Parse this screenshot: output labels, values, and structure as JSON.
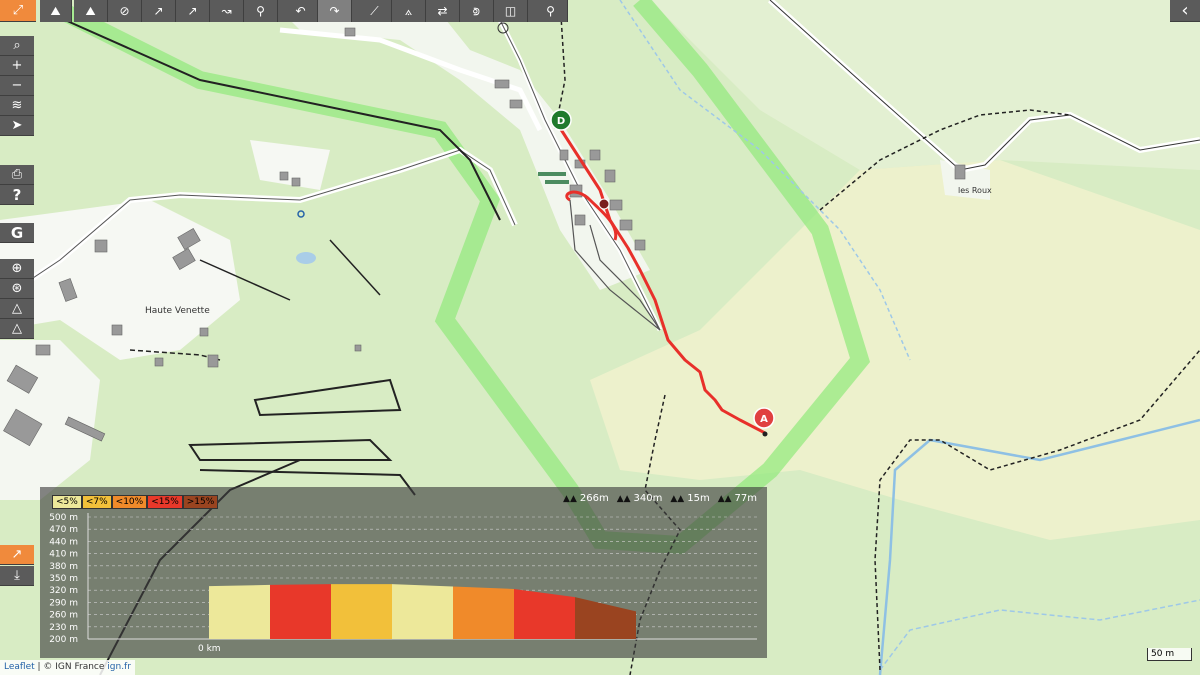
{
  "map": {
    "labels": [
      {
        "key": "haute_venette",
        "text": "Haute Venette"
      },
      {
        "key": "les_roux",
        "text": "les Roux"
      },
      {
        "key": "marker_start",
        "text": "D"
      },
      {
        "key": "marker_end",
        "text": "A"
      }
    ],
    "colors": {
      "track": "#e8302a",
      "forest": "#c9e4ad",
      "meadow": "#eef2cc",
      "park_border": "#8fe87a",
      "water": "#9ec8e8"
    }
  },
  "toolbar": {
    "items": [
      {
        "name": "hiker-icon",
        "glyph": "⛰"
      },
      {
        "name": "hide-route-icon",
        "glyph": "⊘"
      },
      {
        "name": "line-mode-icon",
        "glyph": "↗"
      },
      {
        "name": "line-mode-2-icon",
        "glyph": "↗"
      },
      {
        "name": "route-mode-icon",
        "glyph": "↝"
      },
      {
        "name": "bike-icon",
        "glyph": "⚲"
      },
      {
        "name": "undo-icon",
        "glyph": "↶"
      },
      {
        "name": "redo-icon",
        "glyph": "↷"
      },
      {
        "name": "route-edit-icon",
        "glyph": "⟋"
      },
      {
        "name": "route-split-icon",
        "glyph": "⟑"
      },
      {
        "name": "reverse-icon",
        "glyph": "⇄"
      },
      {
        "name": "ruler-icon",
        "glyph": "⟄"
      },
      {
        "name": "layers-select-icon",
        "glyph": "◫"
      },
      {
        "name": "pin-icon",
        "glyph": "⚲"
      }
    ]
  },
  "controls": {
    "expand_glyph": "⤢",
    "search_glyph": "⌕",
    "zoom_in": "+",
    "zoom_out": "−",
    "layers_glyph": "≋",
    "locate_glyph": "➤",
    "print_glyph": "⎙",
    "help_glyph": "?",
    "google_glyph": "G",
    "target_glyph": "⊕",
    "globe_glyph": "⊛",
    "tools1_glyph": "△",
    "tools2_glyph": "△",
    "chart_glyph": "↗",
    "download_glyph": "⤓",
    "back_glyph": "‹"
  },
  "attribution": {
    "leaflet": "Leaflet",
    "sep": " | © IGN France ",
    "site": "ign.fr"
  },
  "scale": {
    "label": "50 m"
  },
  "elevation": {
    "legend": [
      {
        "text": "<5%",
        "color": "#ede89a"
      },
      {
        "text": "<7%",
        "color": "#f2c03a"
      },
      {
        "text": "<10%",
        "color": "#f08a2a"
      },
      {
        "text": "<15%",
        "color": "#e8382a"
      },
      {
        "text": ">15%",
        "color": "#9a4420"
      }
    ],
    "stats": [
      {
        "name": "max-elevation",
        "value": "266m"
      },
      {
        "name": "min-elevation",
        "value": "340m"
      },
      {
        "name": "ascent",
        "value": "15m"
      },
      {
        "name": "descent",
        "value": "77m"
      }
    ]
  },
  "chart_data": {
    "type": "area",
    "title": "",
    "xlabel": "",
    "ylabel": "",
    "x_tick": "0 km",
    "y_ticks": [
      "500 m",
      "470 m",
      "440 m",
      "410 m",
      "380 m",
      "350 m",
      "320 m",
      "290 m",
      "260 m",
      "230 m",
      "200 m"
    ],
    "ylim": [
      200,
      500
    ],
    "segments": [
      {
        "y_start": 330,
        "y_end": 333,
        "color": "#ede89a"
      },
      {
        "y_start": 333,
        "y_end": 335,
        "color": "#e8382a"
      },
      {
        "y_start": 335,
        "y_end": 335,
        "color": "#f2c03a"
      },
      {
        "y_start": 335,
        "y_end": 329,
        "color": "#ede89a"
      },
      {
        "y_start": 329,
        "y_end": 323,
        "color": "#f08a2a"
      },
      {
        "y_start": 323,
        "y_end": 303,
        "color": "#e8382a"
      },
      {
        "y_start": 303,
        "y_end": 268,
        "color": "#9a4420"
      }
    ]
  }
}
